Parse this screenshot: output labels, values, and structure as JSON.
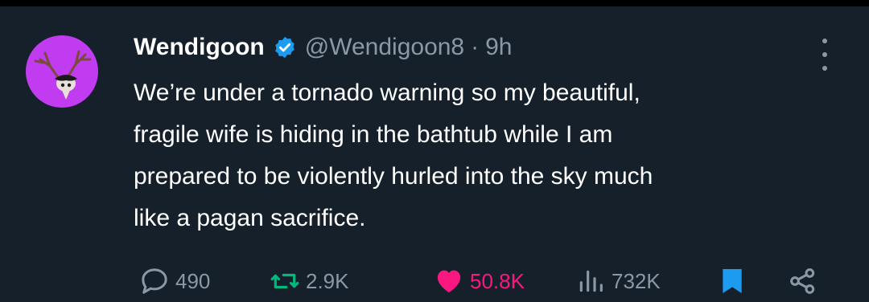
{
  "author": {
    "name": "Wendigoon",
    "handle": "@Wendigoon8",
    "separator": "·",
    "time": "9h",
    "verified": true,
    "avatar_icon": "deer-skull-avatar-icon"
  },
  "tweet": {
    "lines": [
      "We’re under a tornado warning so my beautiful,",
      "fragile wife is hiding in the bathtub while I am",
      "prepared to be violently hurled into the sky much",
      "like a pagan sacrifice."
    ]
  },
  "actions": {
    "replies": "490",
    "reposts": "2.9K",
    "likes": "50.8K",
    "views": "732K"
  },
  "colors": {
    "background": "#15202b",
    "accent_blue": "#1d9bf0",
    "like_pink": "#f91880",
    "repost_green": "#00ba7c",
    "muted": "#8b98a5",
    "avatar_bg": "#c13cf0"
  },
  "icons": {
    "more": "more-vertical-icon",
    "reply": "reply-icon",
    "repost": "repost-icon",
    "like": "heart-icon",
    "views": "views-icon",
    "bookmark": "bookmark-icon",
    "share": "share-icon"
  }
}
